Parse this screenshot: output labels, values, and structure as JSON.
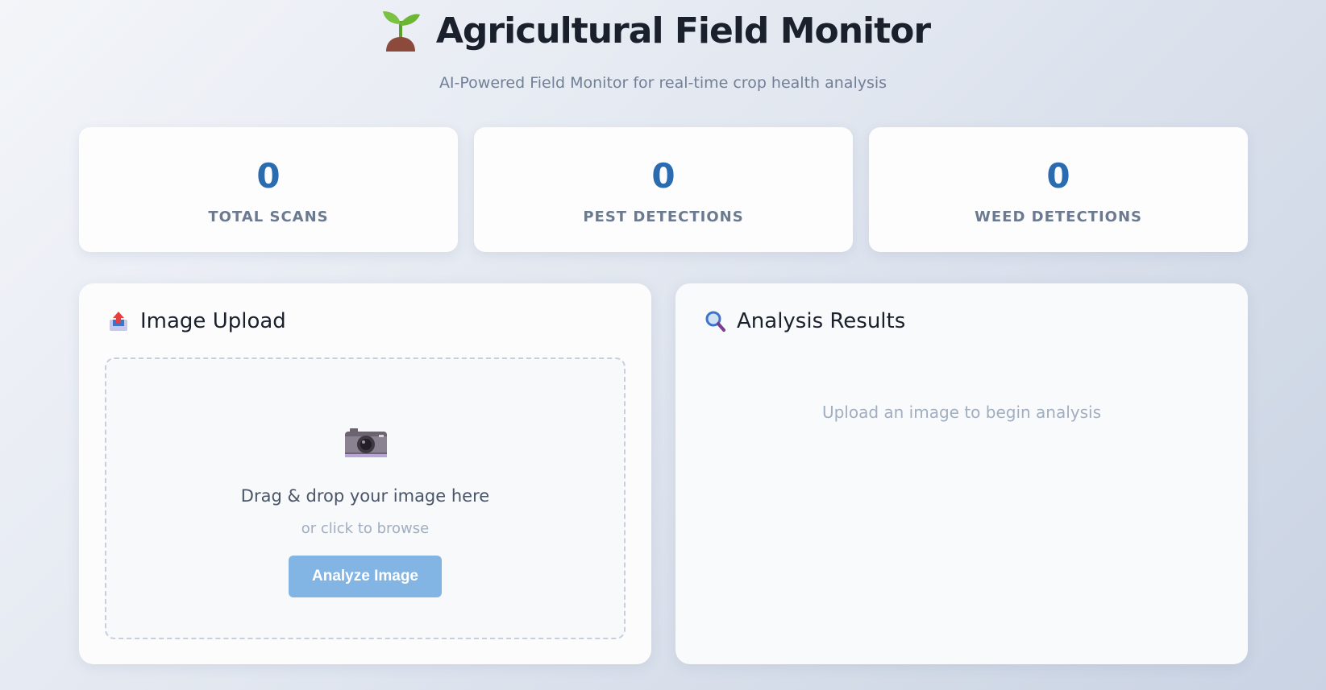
{
  "header": {
    "title": "Agricultural Field Monitor",
    "subtitle": "AI-Powered Field Monitor for real-time crop health analysis",
    "icon": "sprout-icon"
  },
  "stats": [
    {
      "value": "0",
      "label": "TOTAL SCANS"
    },
    {
      "value": "0",
      "label": "PEST DETECTIONS"
    },
    {
      "value": "0",
      "label": "WEED DETECTIONS"
    }
  ],
  "upload": {
    "title": "Image Upload",
    "icon": "inbox-upload-icon",
    "drop_text": "Drag & drop your image here",
    "drop_sub": "or click to browse",
    "button_label": "Analyze Image",
    "button_color": "#82b4e4"
  },
  "results": {
    "title": "Analysis Results",
    "icon": "magnifier-icon",
    "placeholder": "Upload an image to begin analysis"
  },
  "colors": {
    "accent": "#2b6cb0",
    "text_primary": "#1a202c",
    "text_muted": "#718096"
  }
}
